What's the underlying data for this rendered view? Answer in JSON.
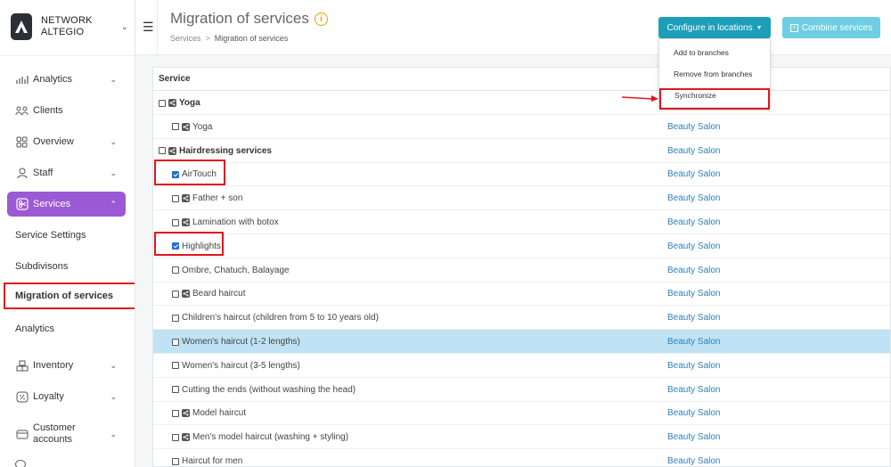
{
  "brand": {
    "line1": "NETWORK",
    "line2": "ALTEGIO"
  },
  "sidebar": {
    "items": [
      {
        "label": "Analytics",
        "icon": "analytics-icon",
        "chevron": true
      },
      {
        "label": "Clients",
        "icon": "clients-icon",
        "chevron": false
      },
      {
        "label": "Overview",
        "icon": "overview-icon",
        "chevron": true
      },
      {
        "label": "Staff",
        "icon": "staff-icon",
        "chevron": true
      },
      {
        "label": "Services",
        "icon": "scissors-icon",
        "chevron": true,
        "active": true
      }
    ],
    "sub_items": [
      "Service Settings",
      "Subdivisons",
      "Migration of services",
      "Analytics"
    ],
    "bottom_items": [
      {
        "label": "Inventory",
        "icon": "inventory-icon"
      },
      {
        "label": "Loyalty",
        "icon": "loyalty-icon"
      },
      {
        "label": "Customer accounts",
        "icon": "wallet-icon"
      }
    ]
  },
  "header": {
    "title": "Migration of services",
    "breadcrumb": [
      "Services",
      "Migration of services"
    ],
    "config_button": "Configure in locations",
    "combine_button": "Combine services"
  },
  "dropdown": {
    "items": [
      "Add to branches",
      "Remove from branches",
      "Synchronize"
    ]
  },
  "table": {
    "header": "Service",
    "rows": [
      {
        "name": "Yoga",
        "group": true,
        "checked": false,
        "share": true,
        "location": ""
      },
      {
        "name": "Yoga",
        "group": false,
        "checked": false,
        "share": true,
        "location": "Beauty Salon"
      },
      {
        "name": "Hairdressing services",
        "group": true,
        "checked": false,
        "share": true,
        "location": "Beauty Salon"
      },
      {
        "name": "AirTouch",
        "group": false,
        "checked": true,
        "share": false,
        "location": "Beauty Salon"
      },
      {
        "name": "Father + son",
        "group": false,
        "checked": false,
        "share": true,
        "location": "Beauty Salon"
      },
      {
        "name": "Lamination with botox",
        "group": false,
        "checked": false,
        "share": true,
        "location": "Beauty Salon"
      },
      {
        "name": "Highlights",
        "group": false,
        "checked": true,
        "share": false,
        "location": "Beauty Salon"
      },
      {
        "name": "Ombre, Chatuch, Balayage",
        "group": false,
        "checked": false,
        "share": false,
        "location": "Beauty Salon"
      },
      {
        "name": "Beard haircut",
        "group": false,
        "checked": false,
        "share": true,
        "location": "Beauty Salon"
      },
      {
        "name": "Children's haircut (children from 5 to 10 years old)",
        "group": false,
        "checked": false,
        "share": false,
        "location": "Beauty Salon"
      },
      {
        "name": "Women's haircut (1-2 lengths)",
        "group": false,
        "checked": false,
        "share": false,
        "location": "Beauty Salon",
        "highlighted": true
      },
      {
        "name": "Women's haircut (3-5 lengths)",
        "group": false,
        "checked": false,
        "share": false,
        "location": "Beauty Salon"
      },
      {
        "name": "Cutting the ends (without washing the head)",
        "group": false,
        "checked": false,
        "share": false,
        "location": "Beauty Salon"
      },
      {
        "name": "Model haircut",
        "group": false,
        "checked": false,
        "share": true,
        "location": "Beauty Salon"
      },
      {
        "name": "Men's model haircut (washing + styling)",
        "group": false,
        "checked": false,
        "share": true,
        "location": "Beauty Salon"
      },
      {
        "name": "Haircut for men",
        "group": false,
        "checked": false,
        "share": false,
        "location": "Beauty Salon"
      }
    ]
  },
  "colors": {
    "accent_purple": "#9b59d6",
    "primary_button": "#1d9eb8",
    "secondary_button": "#6fcee3",
    "link_blue": "#2e7fb8",
    "annotation_red": "#e0161d",
    "row_highlight": "#bfe3f4"
  }
}
